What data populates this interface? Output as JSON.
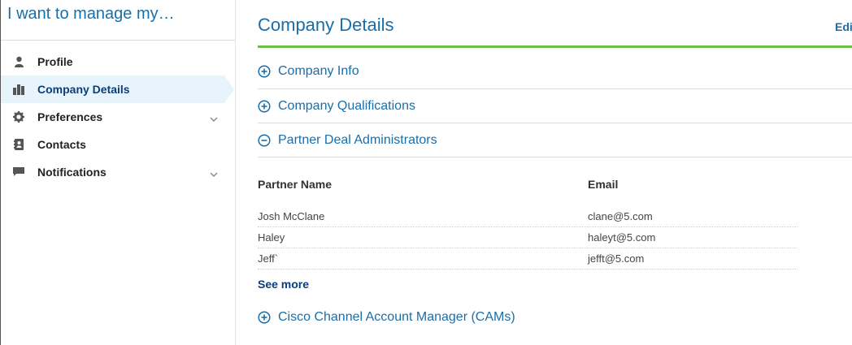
{
  "sidebar": {
    "title": "I want to manage my…",
    "items": [
      {
        "label": "Profile",
        "icon": "person-icon",
        "expandable": false,
        "active": false
      },
      {
        "label": "Company Details",
        "icon": "building-icon",
        "expandable": false,
        "active": true
      },
      {
        "label": "Preferences",
        "icon": "gear-icon",
        "expandable": true,
        "active": false
      },
      {
        "label": "Contacts",
        "icon": "contact-book-icon",
        "expandable": false,
        "active": false
      },
      {
        "label": "Notifications",
        "icon": "message-icon",
        "expandable": true,
        "active": false
      }
    ]
  },
  "main": {
    "title": "Company Details",
    "edit_label": "Edi",
    "sections": [
      {
        "label": "Company Info",
        "expanded": false
      },
      {
        "label": "Company Qualifications",
        "expanded": false
      },
      {
        "label": "Partner Deal Administrators",
        "expanded": true
      }
    ],
    "table": {
      "headers": [
        "Partner Name",
        "Email"
      ],
      "rows": [
        [
          "Josh McClane",
          "clane@5.com"
        ],
        [
          "Haley",
          "haleyt@5.com"
        ],
        [
          "Jeff`",
          "jefft@5.com"
        ]
      ]
    },
    "see_more_label": "See more",
    "last_section": {
      "label": "Cisco Channel Account Manager (CAMs)",
      "expanded": false
    }
  },
  "colors": {
    "accent_blue": "#1a6ea8",
    "active_bg": "#e8f4fb",
    "green_rule": "#6cc04a"
  }
}
